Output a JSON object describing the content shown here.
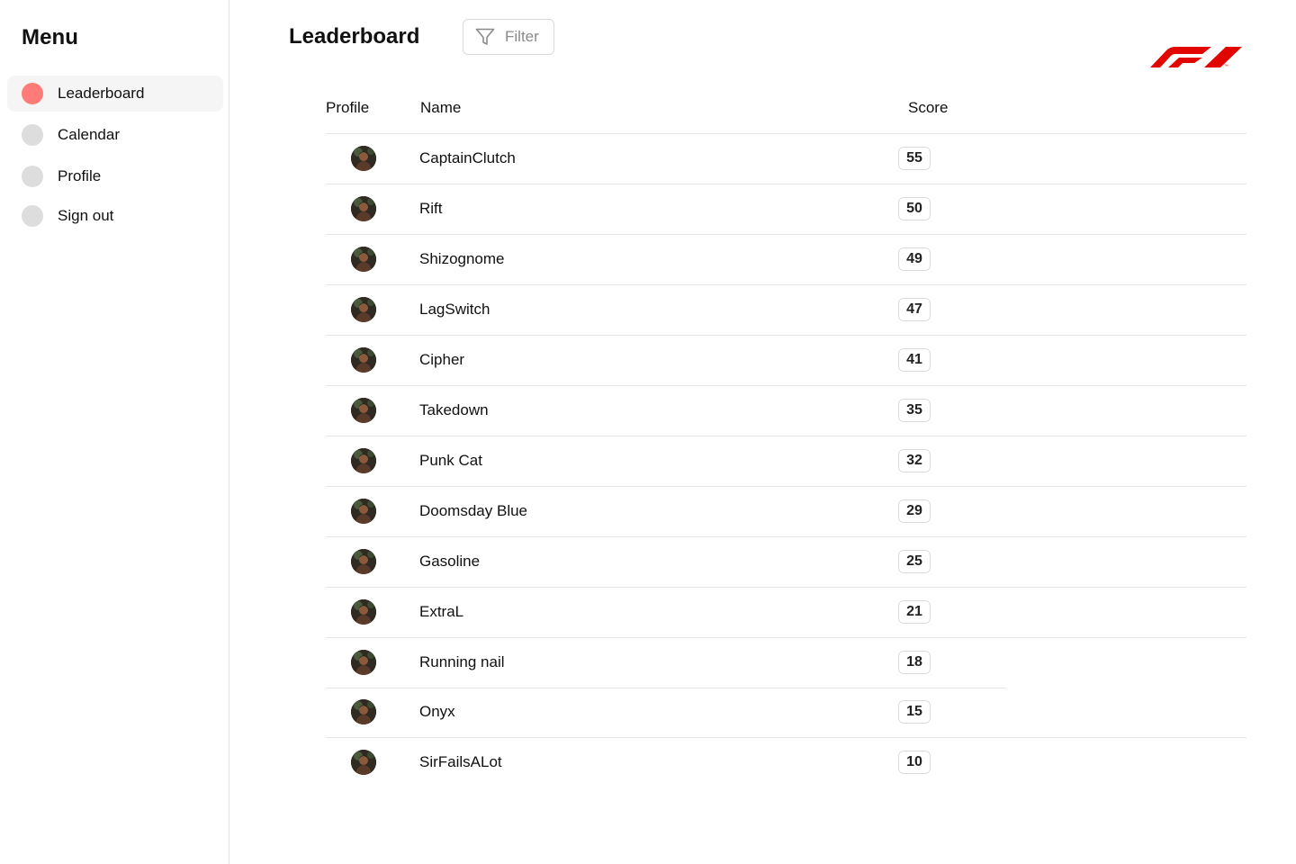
{
  "sidebar": {
    "title": "Menu",
    "items": [
      {
        "label": "Leaderboard",
        "active": true
      },
      {
        "label": "Calendar",
        "active": false
      },
      {
        "label": "Profile",
        "active": false
      },
      {
        "label": "Sign out",
        "active": false
      }
    ]
  },
  "header": {
    "title": "Leaderboard",
    "filter_label": "Filter",
    "filter_icon": "funnel-icon",
    "logo_icon": "f1-logo"
  },
  "table": {
    "columns": [
      "Profile",
      "Name",
      "Score"
    ],
    "rows": [
      {
        "name": "CaptainClutch",
        "score": "55"
      },
      {
        "name": "Rift",
        "score": "50"
      },
      {
        "name": "Shizognome",
        "score": "49"
      },
      {
        "name": "LagSwitch",
        "score": "47"
      },
      {
        "name": "Cipher",
        "score": "41"
      },
      {
        "name": "Takedown",
        "score": "35"
      },
      {
        "name": "Punk Cat",
        "score": "32"
      },
      {
        "name": "Doomsday Blue",
        "score": "29"
      },
      {
        "name": "Gasoline",
        "score": "25"
      },
      {
        "name": "ExtraL",
        "score": "21"
      },
      {
        "name": "Running nail",
        "score": "18"
      },
      {
        "name": "Onyx",
        "score": "15"
      },
      {
        "name": "SirFailsALot",
        "score": "10"
      }
    ]
  },
  "colors": {
    "accent": "#ff7b77",
    "inactive_dot": "#dddddd",
    "logo_red": "#e10600",
    "divider": "#e4e4e4"
  }
}
